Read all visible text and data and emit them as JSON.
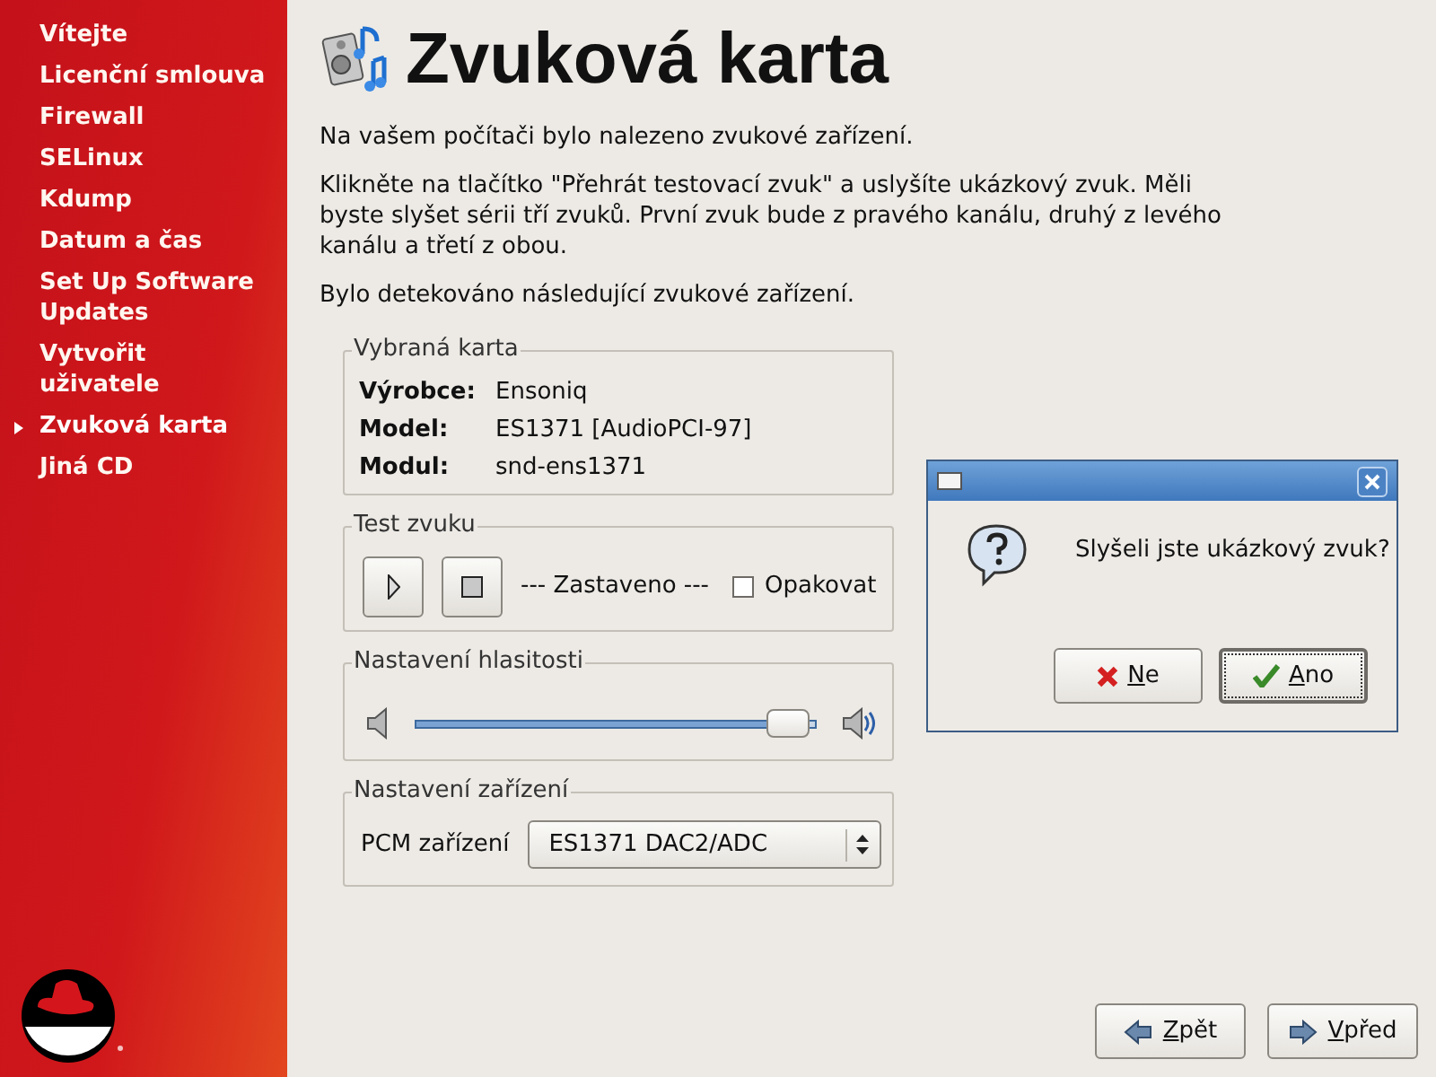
{
  "sidebar": {
    "items": [
      {
        "label": "Vítejte",
        "selected": false
      },
      {
        "label": "Licenční smlouva",
        "selected": false
      },
      {
        "label": "Firewall",
        "selected": false
      },
      {
        "label": "SELinux",
        "selected": false
      },
      {
        "label": "Kdump",
        "selected": false
      },
      {
        "label": "Datum a čas",
        "selected": false
      },
      {
        "label": "Set Up Software Updates",
        "selected": false
      },
      {
        "label": "Vytvořit uživatele",
        "selected": false
      },
      {
        "label": "Zvuková karta",
        "selected": true
      },
      {
        "label": "Jiná CD",
        "selected": false
      }
    ]
  },
  "page": {
    "title": "Zvuková karta",
    "paragraphs": [
      "Na vašem počítači bylo nalezeno zvukové zařízení.",
      "Klikněte na tlačítko \"Přehrát testovací zvuk\" a uslyšíte ukázkový zvuk. Měli byste slyšet sérii tří zvuků. První zvuk bude z pravého kanálu, druhý z levého kanálu a třetí z obou.",
      "Bylo detekováno následující zvukové zařízení."
    ]
  },
  "card_frame": {
    "legend": "Vybraná karta",
    "rows": [
      {
        "label": "Výrobce:",
        "value": "Ensoniq"
      },
      {
        "label": "Model:",
        "value": "ES1371 [AudioPCI-97]"
      },
      {
        "label": "Modul:",
        "value": "snd-ens1371"
      }
    ]
  },
  "test_frame": {
    "legend": "Test zvuku",
    "status": "--- Zastaveno ---",
    "repeat": {
      "label": "Opakovat",
      "checked": false
    }
  },
  "volume_frame": {
    "legend": "Nastavení hlasitosti",
    "level": 0.93
  },
  "device_frame": {
    "legend": "Nastavení zařízení",
    "label": "PCM zařízení",
    "value": "ES1371 DAC2/ADC"
  },
  "dialog": {
    "question": "Slyšeli jste ukázkový zvuk?",
    "buttons": [
      {
        "label": "Ne",
        "kind": "no",
        "focused": false
      },
      {
        "label": "Ano",
        "kind": "yes",
        "focused": true
      }
    ]
  },
  "nav_buttons": [
    {
      "label": "Zpět",
      "kind": "back"
    },
    {
      "label": "Vpřed",
      "kind": "forward"
    }
  ]
}
